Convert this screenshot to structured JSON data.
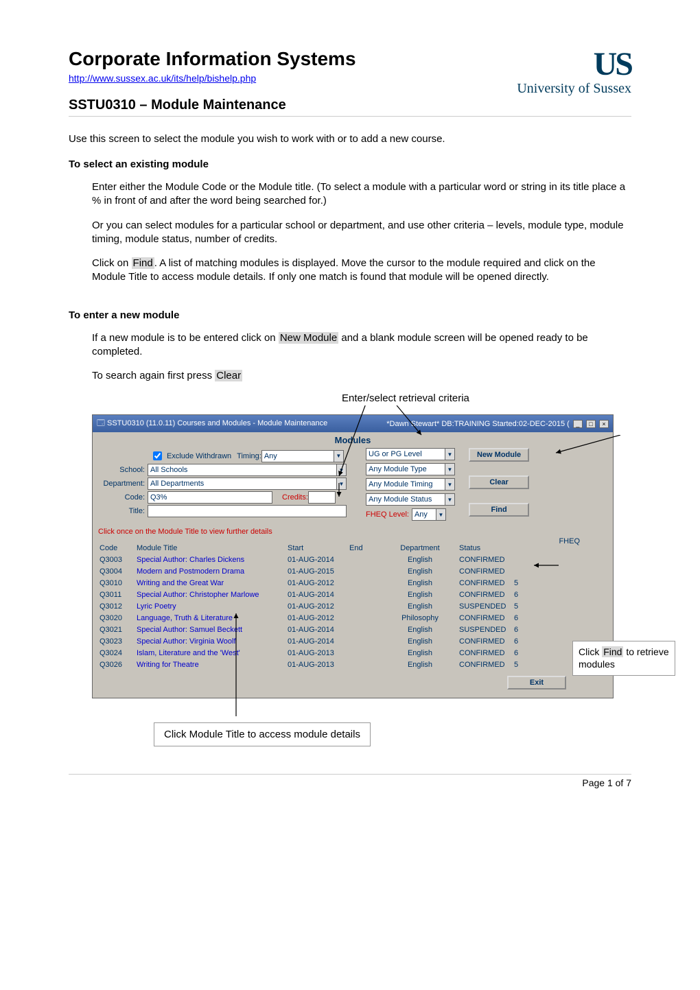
{
  "header": {
    "title": "Corporate Information Systems",
    "link_text": "http://www.sussex.ac.uk/its/help/bishelp.php",
    "subtitle": "SSTU0310 – Module Maintenance",
    "logo_mark": "US",
    "logo_sub": "University of Sussex"
  },
  "intro": "Use this screen to select the module you wish to work with or to add a new course.",
  "section1": {
    "heading": "To select an existing module",
    "p1": "Enter either the Module Code or the Module title. (To select a module with a particular word or string in its title place a % in front of and after the word being searched for.)",
    "p2": "Or you can select modules for a particular school or department, and use other criteria – levels, module type, module timing, module status, number of credits.",
    "p3a": "Click on ",
    "p3b": "Find",
    "p3c": ". A list of matching modules is displayed. Move the cursor to the module required and click on the Module Title to access module details.  If only one match is found that module will be opened directly."
  },
  "section2": {
    "heading": "To enter a new module",
    "p1a": "If a new module is to be entered click on ",
    "p1b": "New Module",
    "p1c": " and a blank module screen will be opened ready to be completed.",
    "p2a": "To search again first press ",
    "p2b": "Clear"
  },
  "callouts": {
    "top": "Enter/select retrieval criteria",
    "right_a": "Click ",
    "right_b": "Find",
    "right_c": " to retrieve modules",
    "bottom": "Click Module Title to access module details"
  },
  "app": {
    "title_left": "SSTU0310 (11.0.11) Courses and Modules - Module Maintenance",
    "title_right": "*Dawn Stewart* DB:TRAINING Started:02-DEC-2015 (",
    "form_title": "Modules",
    "checkbox_label": "Exclude Withdrawn",
    "timing_label": "Timing:",
    "school_label": "School:",
    "dept_label": "Department:",
    "code_label": "Code:",
    "title_label": "Title:",
    "credits_label": "Credits:",
    "fheq_label": "FHEQ Level:",
    "fields": {
      "timing": "Any",
      "school": "All Schools",
      "department": "All Departments",
      "code": "Q3%",
      "title": "",
      "credits": "",
      "level": "UG or PG Level",
      "mod_type": "Any Module Type",
      "mod_timing": "Any Module Timing",
      "mod_status": "Any Module Status",
      "fheq": "Any"
    },
    "buttons": {
      "new_module": "New Module",
      "clear": "Clear",
      "find": "Find",
      "exit": "Exit"
    },
    "instruction": "Click once on the Module Title to view further details",
    "fheq_header": "FHEQ",
    "columns": {
      "code": "Code",
      "title": "Module Title",
      "start": "Start",
      "end": "End",
      "dept": "Department",
      "status": "Status"
    },
    "rows": [
      {
        "code": "Q3003",
        "title": "Special Author: Charles Dickens",
        "start": "01-AUG-2014",
        "end": "",
        "dept": "English",
        "status": "CONFIRMED",
        "fheq": ""
      },
      {
        "code": "Q3004",
        "title": "Modern and Postmodern Drama",
        "start": "01-AUG-2015",
        "end": "",
        "dept": "English",
        "status": "CONFIRMED",
        "fheq": ""
      },
      {
        "code": "Q3010",
        "title": "Writing and the Great War",
        "start": "01-AUG-2012",
        "end": "",
        "dept": "English",
        "status": "CONFIRMED",
        "fheq": "5"
      },
      {
        "code": "Q3011",
        "title": "Special Author: Christopher Marlowe",
        "start": "01-AUG-2014",
        "end": "",
        "dept": "English",
        "status": "CONFIRMED",
        "fheq": "6"
      },
      {
        "code": "Q3012",
        "title": "Lyric Poetry",
        "start": "01-AUG-2012",
        "end": "",
        "dept": "English",
        "status": "SUSPENDED",
        "fheq": "5"
      },
      {
        "code": "Q3020",
        "title": "Language, Truth & Literature",
        "start": "01-AUG-2012",
        "end": "",
        "dept": "Philosophy",
        "status": "CONFIRMED",
        "fheq": "6"
      },
      {
        "code": "Q3021",
        "title": "Special Author: Samuel Beckett",
        "start": "01-AUG-2014",
        "end": "",
        "dept": "English",
        "status": "SUSPENDED",
        "fheq": "6"
      },
      {
        "code": "Q3023",
        "title": "Special Author: Virginia Woolf",
        "start": "01-AUG-2014",
        "end": "",
        "dept": "English",
        "status": "CONFIRMED",
        "fheq": "6"
      },
      {
        "code": "Q3024",
        "title": "Islam, Literature and the 'West'",
        "start": "01-AUG-2013",
        "end": "",
        "dept": "English",
        "status": "CONFIRMED",
        "fheq": "6"
      },
      {
        "code": "Q3026",
        "title": "Writing for Theatre",
        "start": "01-AUG-2013",
        "end": "",
        "dept": "English",
        "status": "CONFIRMED",
        "fheq": "5"
      }
    ]
  },
  "footer": "Page 1 of 7"
}
